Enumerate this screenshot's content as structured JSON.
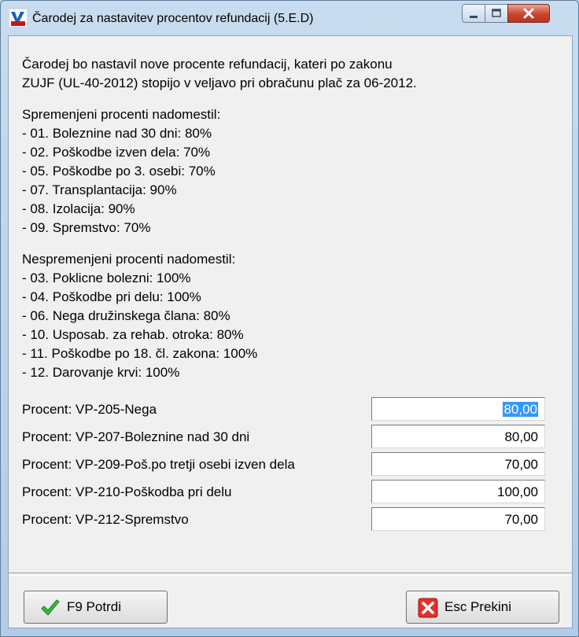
{
  "window": {
    "title": "Čarodej za nastavitev procentov refundacij  (5.E.D)"
  },
  "intro": [
    "Čarodej bo nastavil nove procente refundacij, kateri po zakonu",
    "ZUJF (UL-40-2012) stopijo v veljavo pri obračunu plač za 06-2012."
  ],
  "changed": {
    "heading": "Spremenjeni procenti nadomestil:",
    "items": [
      " - 01. Boleznine nad 30 dni: 80%",
      " - 02. Poškodbe izven dela: 70%",
      " - 05. Poškodbe po 3. osebi: 70%",
      " - 07. Transplantacija: 90%",
      " - 08. Izolacija: 90%",
      " - 09. Spremstvo: 70%"
    ]
  },
  "unchanged": {
    "heading": "Nespremenjeni procenti nadomestil:",
    "items": [
      " - 03. Poklicne bolezni: 100%",
      " - 04. Poškodbe pri delu: 100%",
      " - 06. Nega družinskega člana: 80%",
      " - 10. Usposab. za rehab. otroka: 80%",
      " - 11. Poškodbe po 18. čl. zakona: 100%",
      " - 12. Darovanje krvi: 100%"
    ]
  },
  "fields": [
    {
      "label": "Procent: VP-205-Nega",
      "value": "80,00"
    },
    {
      "label": "Procent: VP-207-Boleznine nad 30 dni",
      "value": "80,00"
    },
    {
      "label": "Procent: VP-209-Poš.po tretji osebi izven dela",
      "value": "70,00"
    },
    {
      "label": "Procent: VP-210-Poškodba pri delu",
      "value": "100,00"
    },
    {
      "label": "Procent: VP-212-Spremstvo",
      "value": "70,00"
    }
  ],
  "buttons": {
    "confirm": "F9 Potrdi",
    "cancel": "Esc Prekini"
  },
  "icons": {
    "app": "app-logo-icon",
    "confirm": "checkmark-icon",
    "cancel": "red-x-icon"
  }
}
